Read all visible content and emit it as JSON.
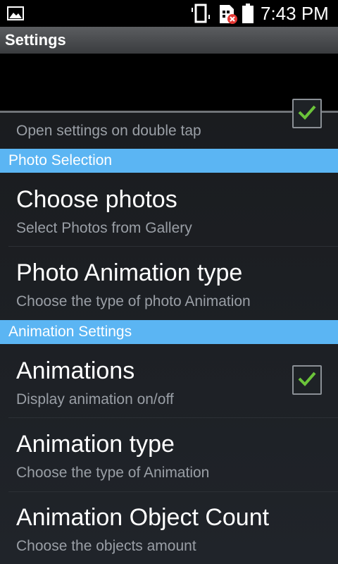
{
  "status_bar": {
    "time": "7:43 PM",
    "icons": [
      "gallery-icon",
      "vibrate-icon",
      "sim-error-icon",
      "battery-icon"
    ]
  },
  "action_bar": {
    "title": "Settings"
  },
  "partial_item": {
    "subtitle": "Open settings on double tap",
    "checked": true
  },
  "sections": {
    "photo": "Photo Selection",
    "animation": "Animation Settings"
  },
  "items": [
    {
      "title": "Choose photos",
      "subtitle": "Select Photos from Gallery"
    },
    {
      "title": "Photo Animation type",
      "subtitle": "Choose the type of  photo Animation"
    },
    {
      "title": "Animations",
      "subtitle": "Display animation on/off",
      "checked": true
    },
    {
      "title": "Animation type",
      "subtitle": "Choose the type of Animation"
    },
    {
      "title": "Animation Object Count",
      "subtitle": "Choose the objects amount"
    }
  ],
  "colors": {
    "section_header": "#5bb5f3",
    "check_mark": "#6bc43a",
    "subtitle": "#9a9fa6"
  }
}
